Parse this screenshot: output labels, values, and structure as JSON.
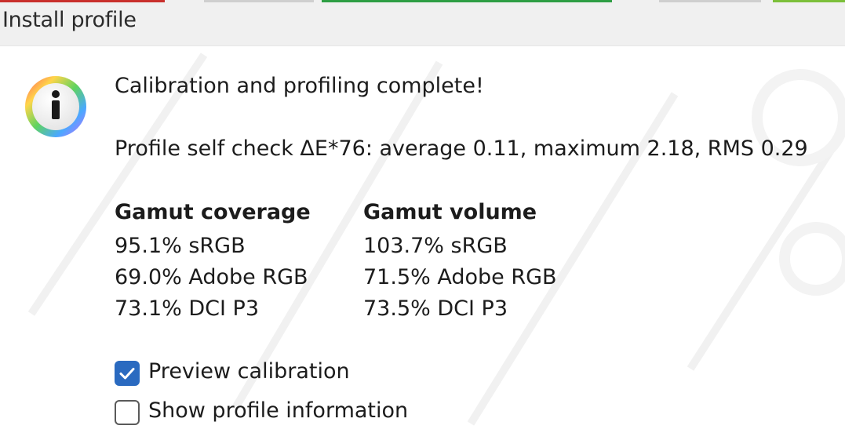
{
  "window": {
    "title": "Install profile"
  },
  "message": {
    "headline": "Calibration and profiling complete!",
    "self_check": "Profile self check ΔE*76: average 0.11, maximum 2.18, RMS 0.29"
  },
  "gamut": {
    "coverage": {
      "heading": "Gamut coverage",
      "rows": [
        "95.1% sRGB",
        "69.0% Adobe RGB",
        "73.1% DCI P3"
      ]
    },
    "volume": {
      "heading": "Gamut volume",
      "rows": [
        "103.7% sRGB",
        "71.5% Adobe RGB",
        "73.5% DCI P3"
      ]
    }
  },
  "options": {
    "preview_calibration": {
      "label": "Preview calibration",
      "checked": true
    },
    "show_profile_info": {
      "label": "Show profile information",
      "checked": false
    }
  },
  "icons": {
    "info": "info-icon",
    "check": "check-icon"
  },
  "colors": {
    "checkbox_accent": "#2a6ac0",
    "titlebar_bg": "#f0f0f0"
  }
}
